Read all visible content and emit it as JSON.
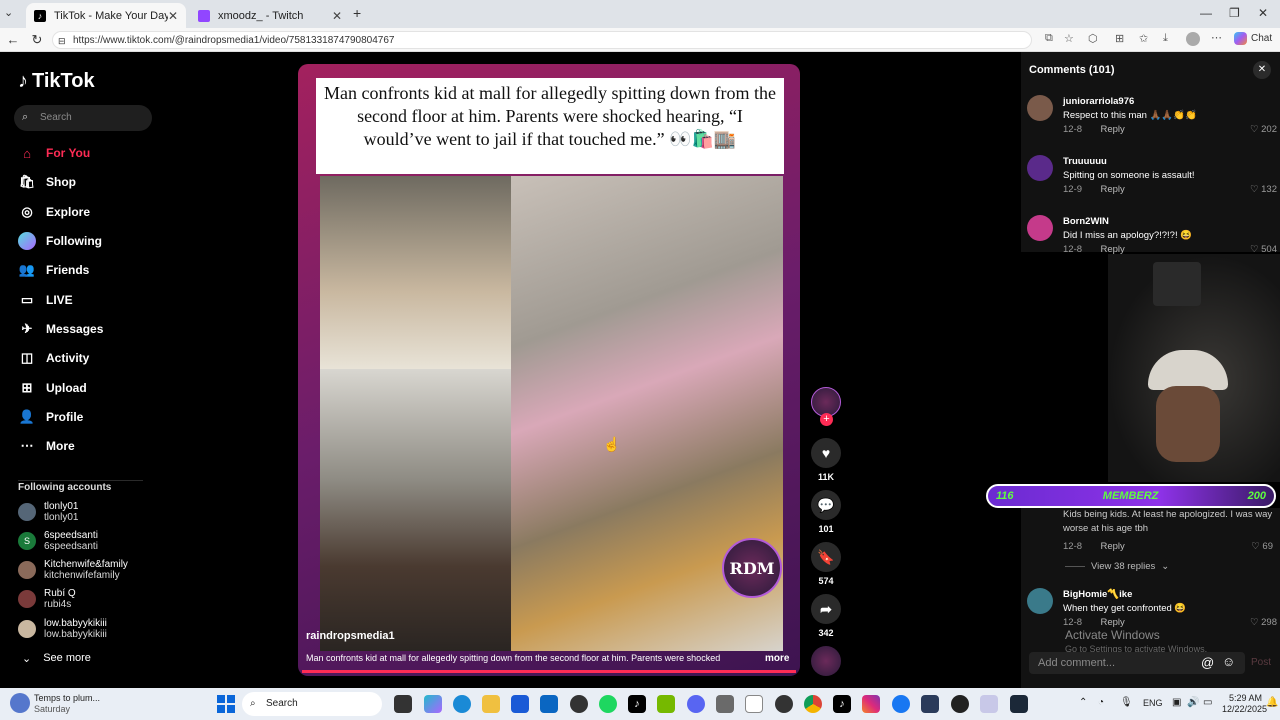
{
  "browser": {
    "tabs": [
      {
        "title": "TikTok - Make Your Day",
        "active": true
      },
      {
        "title": "xmoodz_ - Twitch",
        "active": false
      }
    ],
    "url": "https://www.tiktok.com/@raindropsmedia1/video/7581331874790804767",
    "chat_label": "Chat"
  },
  "tiktok": {
    "logo": "TikTok",
    "search_placeholder": "Search",
    "nav": [
      "For You",
      "Shop",
      "Explore",
      "Following",
      "Friends",
      "LIVE",
      "Messages",
      "Activity",
      "Upload",
      "Profile",
      "More"
    ],
    "following_header": "Following accounts",
    "accounts": [
      {
        "name": "tlonly01",
        "handle": "tlonly01"
      },
      {
        "name": "6speedsanti",
        "handle": "6speedsanti"
      },
      {
        "name": "Kitchenwife&family",
        "handle": "kitchenwifefamily"
      },
      {
        "name": "Rubí Q",
        "handle": "rubi4s"
      },
      {
        "name": "low.babyykikiii",
        "handle": "low.babyykikiii"
      }
    ],
    "see_more": "See more"
  },
  "video": {
    "overlay_text": "Man confronts kid at mall for allegedly spitting down from the second floor at him. Parents were shocked hearing, “I would’ve went to jail if that touched me.” 👀🛍️🏬",
    "author": "raindropsmedia1",
    "description": "Man confronts kid at mall for allegedly spitting down from the second floor at him. Parents were shocked",
    "more_label": "more",
    "watermark": "RDM",
    "likes": "11K",
    "comments": "101",
    "saves": "574",
    "shares": "342"
  },
  "comments_panel": {
    "title": "Comments (101)",
    "items": [
      {
        "user": "juniorarriola976",
        "text": "Respect to this man 🙏🏾🙏🏾👏👏",
        "date": "12-8",
        "reply": "Reply",
        "likes": "202"
      },
      {
        "user": "Truuuuuu",
        "text": "Spitting on someone is assault!",
        "date": "12-9",
        "reply": "Reply",
        "likes": "132"
      },
      {
        "user": "Born2WIN",
        "text": "Did I miss an apology?!?!?! 😆",
        "date": "12-8",
        "reply": "Reply",
        "likes": "504"
      },
      {
        "user": "",
        "text": "Kids being kids. At least he apologized. I was way worse at his age tbh",
        "date": "12-8",
        "reply": "Reply",
        "likes": "69"
      },
      {
        "user": "BigHomie〽️ike",
        "text": "When they get confronted 😆",
        "date": "12-8",
        "reply": "Reply",
        "likes": "298"
      }
    ],
    "view_replies": "View 38 replies",
    "add_comment_placeholder": "Add comment...",
    "post_label": "Post"
  },
  "stream_overlay": {
    "left_count": "116",
    "label": "MEMBERZ",
    "right_count": "200",
    "activate_title": "Activate Windows",
    "activate_sub": "Go to Settings to activate Windows."
  },
  "taskbar": {
    "weather_temp": "Temps to plum...",
    "weather_day": "Saturday",
    "search": "Search",
    "lang": "ENG",
    "time": "5:29 AM",
    "date": "12/22/2025"
  },
  "colors": {
    "accent": "#fe2c55",
    "memberbar": "#8e32e8",
    "membertext": "#5dff3d"
  }
}
